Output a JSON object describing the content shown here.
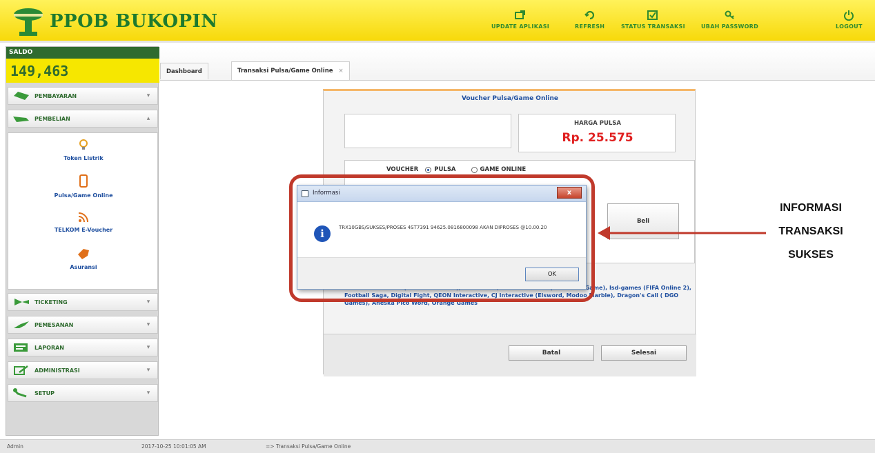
{
  "app": {
    "title": "PPOB BUKOPIN"
  },
  "topnav": [
    {
      "label": "UPDATE APLIKASI",
      "icon": "update-icon"
    },
    {
      "label": "REFRESH",
      "icon": "refresh-icon"
    },
    {
      "label": "STATUS TRANSAKSI",
      "icon": "status-icon"
    },
    {
      "label": "UBAH PASSWORD",
      "icon": "key-icon"
    },
    {
      "label": "LOGOUT",
      "icon": "power-icon"
    }
  ],
  "sidebar": {
    "saldo_label": "SALDO",
    "saldo_value": "149,463",
    "menu": [
      {
        "label": "PEMBAYARAN"
      },
      {
        "label": "PEMBELIAN"
      },
      {
        "label": "TICKETING"
      },
      {
        "label": "PEMESANAN"
      },
      {
        "label": "LAPORAN"
      },
      {
        "label": "ADMINISTRASI"
      },
      {
        "label": "SETUP"
      }
    ],
    "submenu": [
      {
        "label": "Token Listrik",
        "icon": "bulb-icon"
      },
      {
        "label": "Pulsa/Game Online",
        "icon": "phone-icon"
      },
      {
        "label": "TELKOM E-Voucher",
        "icon": "rss-icon"
      },
      {
        "label": "Asuransi",
        "icon": "tag-icon"
      }
    ]
  },
  "tabs": [
    {
      "label": "Dashboard"
    },
    {
      "label": "Transaksi Pulsa/Game Online",
      "close": "×"
    }
  ],
  "form": {
    "title": "Voucher Pulsa/Game Online",
    "price_label": "HARGA PULSA",
    "price_value": "Rp. 25.575",
    "voucher_label": "VOUCHER",
    "option_pulsa": "PULSA",
    "option_game": "GAME ONLINE",
    "beli_label": "Beli",
    "info_text": "FACEBOOK CREDIT (Semesta Games), VTC Online, Kaban Online 2 (Web Base Game), Isd-games (FIFA Online 2), Football Saga, Digital Fight, QEON Interactive, CJ Interactive (Elsword, Modoo Marble), Dragon's Call ( DGO Games), Aneska Pico Word, Orange Games",
    "batal_label": "Batal",
    "selesai_label": "Selesai"
  },
  "modal": {
    "title": "Informasi",
    "close_label": "x",
    "message": "TRX10GBS/SUKSES/PROSES 4ST7391 94625.0816800098 AKAN DIPROSES @10.00.20",
    "ok_label": "OK"
  },
  "annotation": {
    "line1": "INFORMASI",
    "line2": "TRANSAKSI",
    "line3": "SUKSES"
  },
  "statusbar": {
    "user": "Admin",
    "datetime": "2017-10-25 10:01:05 AM",
    "page": "=> Transaksi Pulsa/Game Online"
  },
  "colors": {
    "header_yellow": "#f7d90a",
    "brand_green": "#1e7a2e",
    "price_red": "#e02020",
    "highlight_red": "#c0392b"
  }
}
